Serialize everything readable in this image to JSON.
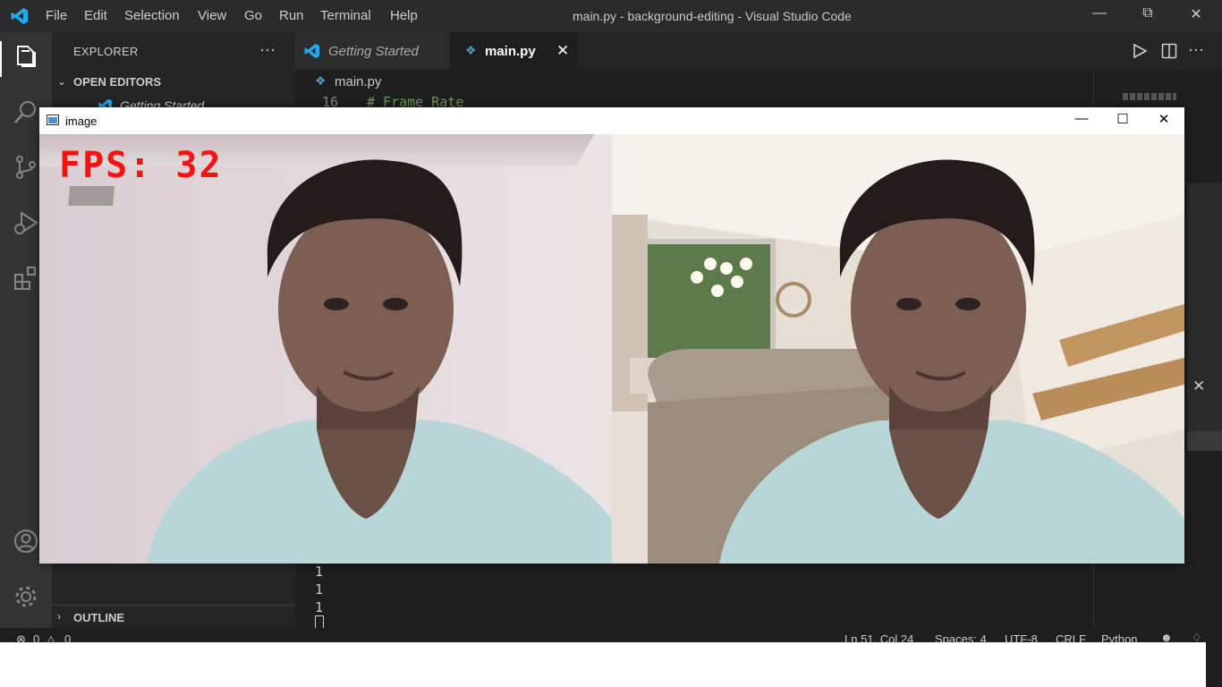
{
  "titlebar": {
    "menu": [
      "File",
      "Edit",
      "Selection",
      "View",
      "Go",
      "Run",
      "Terminal",
      "Help"
    ],
    "window_title": "main.py - background-editing - Visual Studio Code"
  },
  "sidebar": {
    "header": "EXPLORER",
    "more": "···",
    "open_editors": "OPEN EDITORS",
    "open_editor_item": "Getting Started",
    "outline": "OUTLINE"
  },
  "tabs": [
    {
      "label": "Getting Started"
    },
    {
      "label": "main.py"
    }
  ],
  "breadcrumb": "main.py",
  "editor": {
    "line_number": "16",
    "line_text": "# Frame Rate",
    "terminal_lines": [
      "1",
      "1",
      "1"
    ]
  },
  "statusbar": {
    "errors": "0",
    "warnings": "0",
    "position": "Ln 51, Col 24",
    "spaces": "Spaces: 4",
    "encoding": "UTF-8",
    "eol": "CRLF",
    "language": "Python"
  },
  "image_window": {
    "title": "image",
    "fps_text": "FPS: 32"
  },
  "colors": {
    "accent": "#007acc",
    "fps_text": "#ff1010"
  }
}
